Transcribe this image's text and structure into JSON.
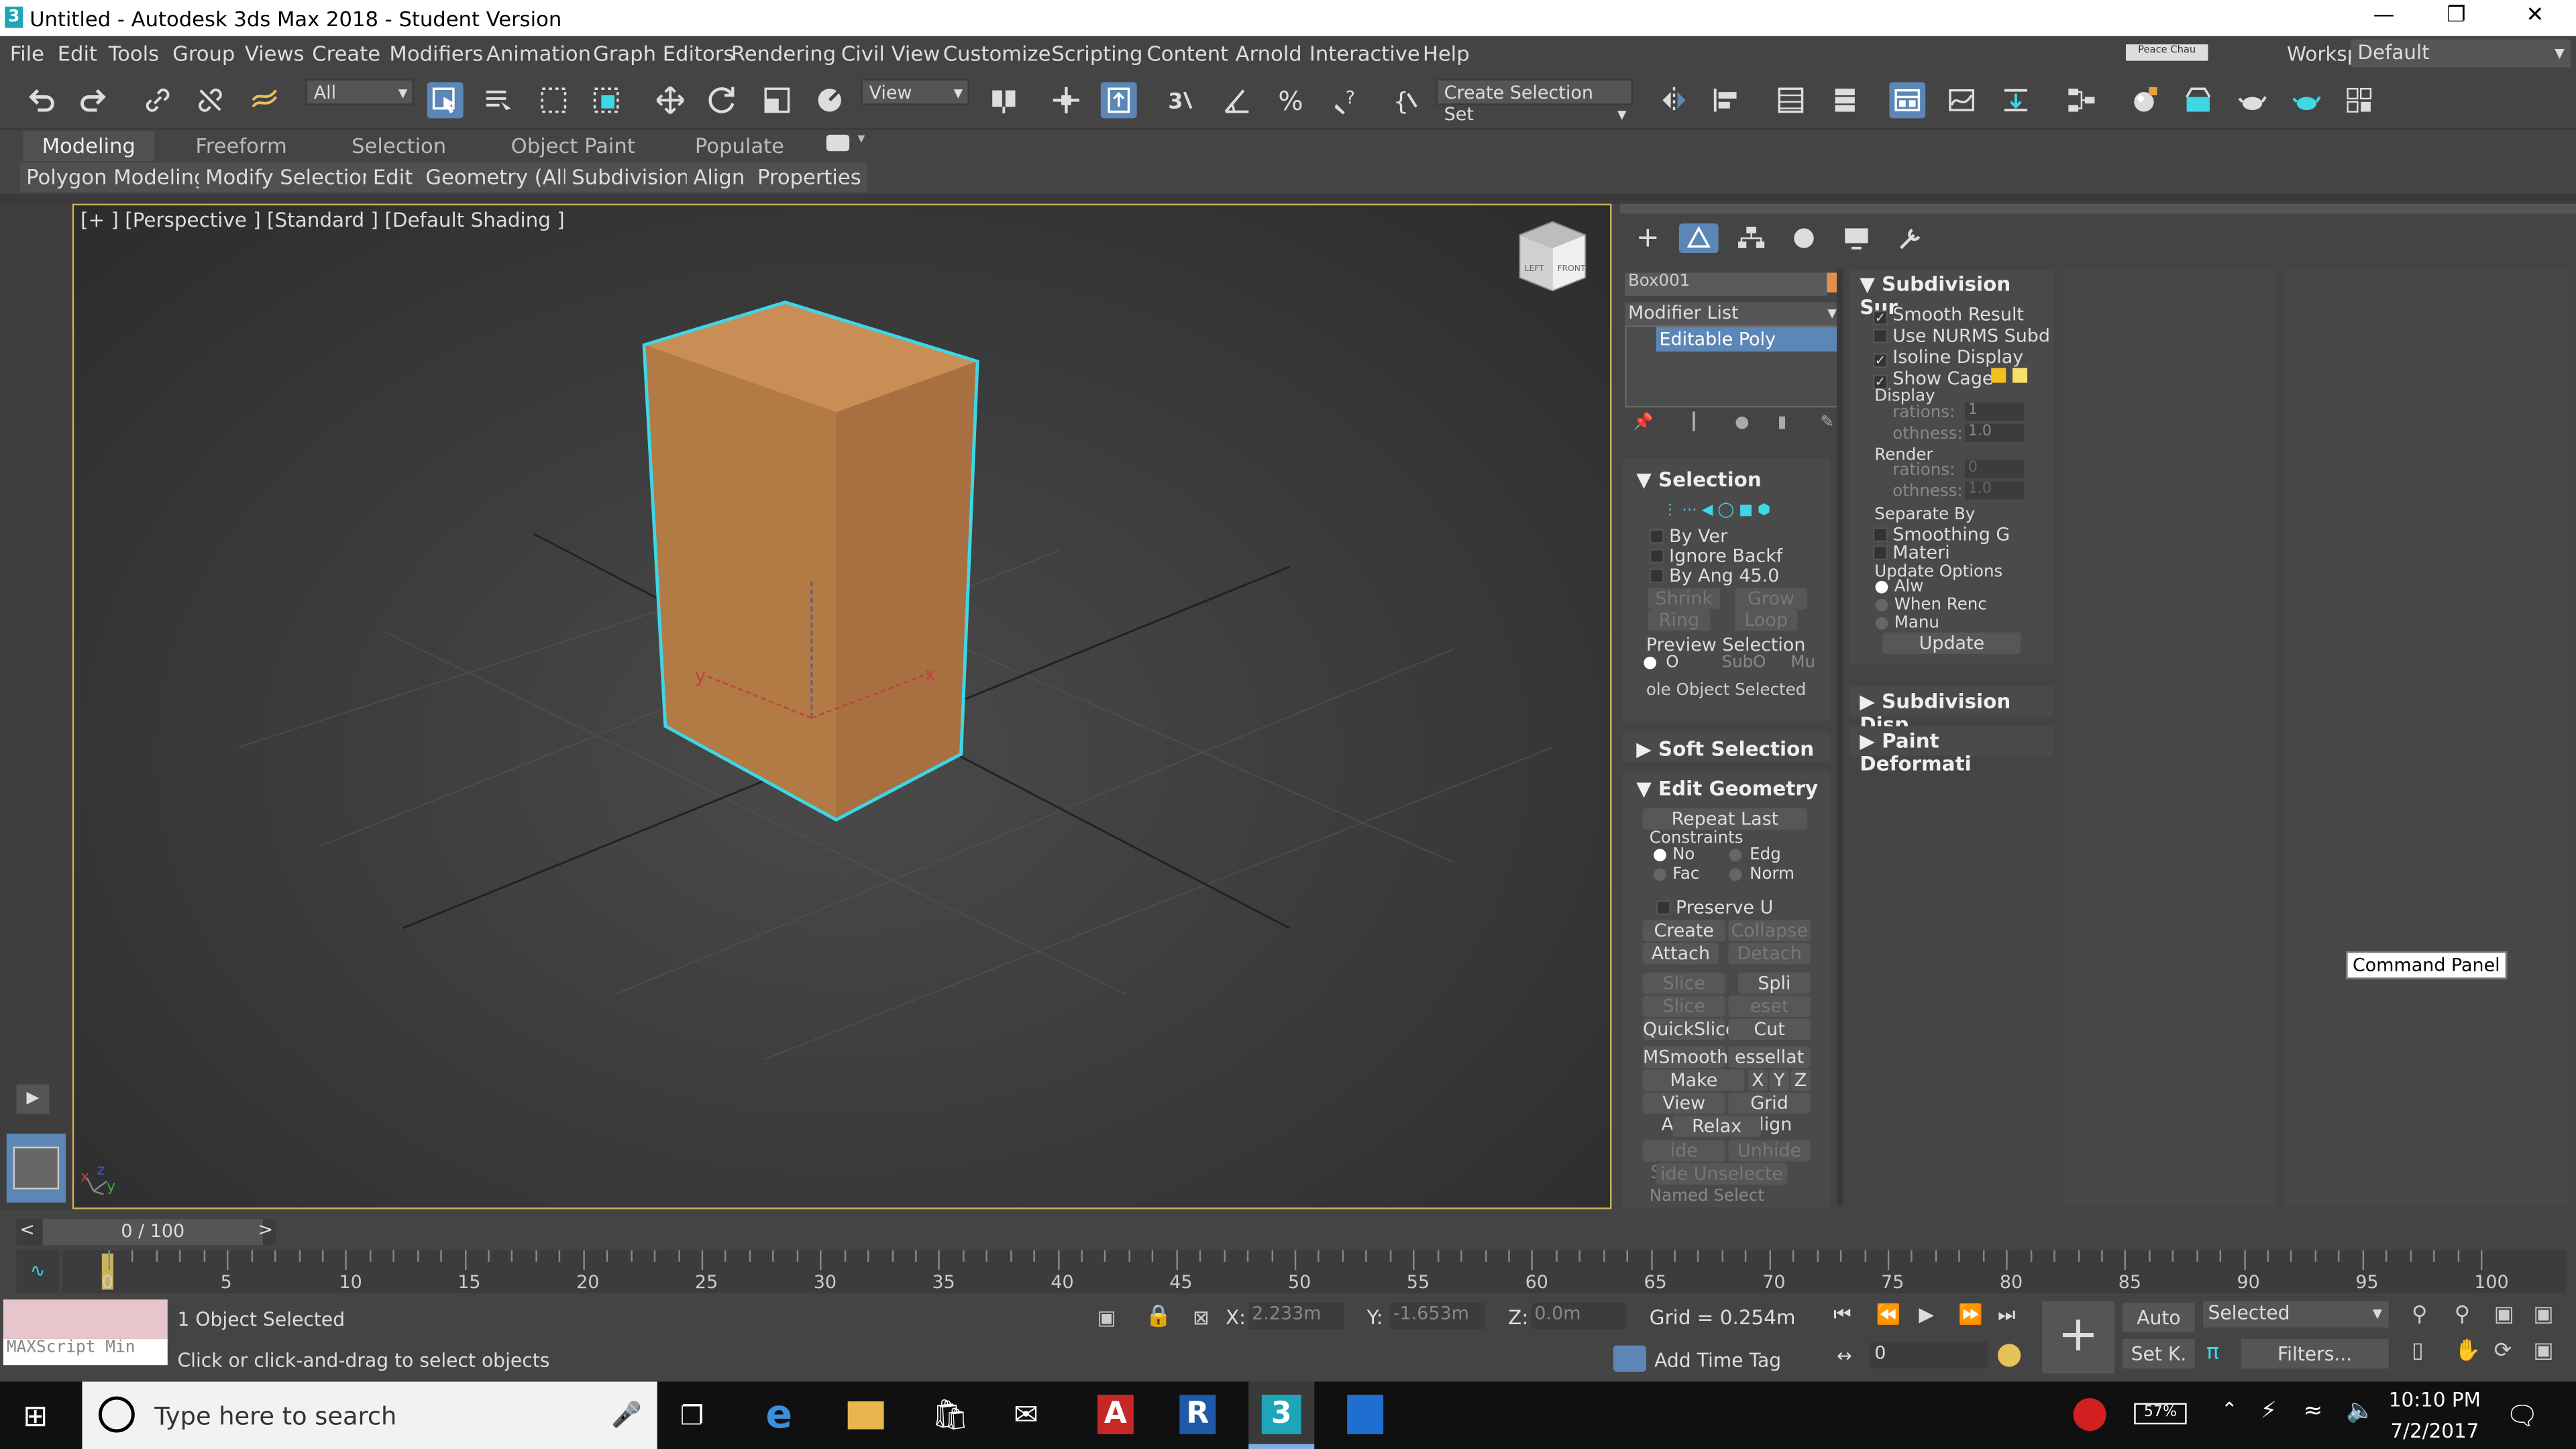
{
  "window": {
    "title": "Untitled - Autodesk 3ds Max 2018 - Student Version"
  },
  "menu": [
    "File",
    "Edit",
    "Tools",
    "Group",
    "Views",
    "Create",
    "Modifiers",
    "Animation",
    "Graph Editors",
    "Rendering",
    "Civil View",
    "Customize",
    "Scripting",
    "Content",
    "Arnold",
    "Interactive",
    "Help"
  ],
  "workspaces": {
    "label": "Workspaces:",
    "value": "Default",
    "user": "Peace Chau"
  },
  "toolbar": {
    "filter_value": "All",
    "refcoord_value": "View",
    "selection_set": "Create Selection Set"
  },
  "ribbon": {
    "tabs": [
      "Modeling",
      "Freeform",
      "Selection",
      "Object Paint",
      "Populate"
    ],
    "subtabs": [
      "Polygon Modeling",
      "Modify Selection",
      "Edit",
      "Geometry (All)",
      "Subdivision",
      "Align",
      "Properties"
    ]
  },
  "viewport": {
    "label": "[+ ] [Perspective ]  [Standard ]  [Default Shading ]",
    "viewcube_left": "LEFT",
    "viewcube_front": "FRONT"
  },
  "command_panel": {
    "object_name": "Box001",
    "modifier_list": "Modifier List",
    "stack_item": "Editable Poly",
    "tooltip": "Command Panel",
    "selection": {
      "title": "Selection",
      "by_vertex": "By Ver",
      "ignore_backfacing": "Ignore Backf",
      "by_angle": "By Ang",
      "by_angle_value": "45.0",
      "shrink": "Shrink",
      "grow": "Grow",
      "ring": "Ring",
      "loop": "Loop",
      "preview_selection": "Preview Selection",
      "preview_off": "O",
      "preview_subobj": "SubO",
      "preview_multi": "Mu",
      "whole_object": "ole Object Selected"
    },
    "soft_selection": {
      "title": "Soft Selection"
    },
    "edit_geometry": {
      "title": "Edit Geometry",
      "repeat_last": "Repeat Last",
      "constraints": "Constraints",
      "none": "No",
      "edge": "Edg",
      "face": "Fac",
      "normal": "Norm",
      "preserve_uvs": "Preserve U",
      "create": "Create",
      "collapse": "Collapse",
      "attach": "Attach",
      "detach": "Detach",
      "slice_plane": "Slice Plane",
      "split": "Spli",
      "slice": "Slice",
      "reset_plane": "eset Plan",
      "quickslice": "QuickSlice",
      "cut": "Cut",
      "msmooth": "MSmooth",
      "tessellate": "essellat",
      "make_planar": "Make Planar",
      "x": "X",
      "y": "Y",
      "z": "Z",
      "view_align": "View Align",
      "grid_align": "Grid Align",
      "relax": "Relax",
      "hide_selected": "ide Selecte",
      "unhide_all": "Unhide All",
      "hide_unselected": "ide Unselecte",
      "named_selections": "Named Select"
    },
    "subdivision_surface": {
      "title": "Subdivision Sur",
      "smooth_result": "Smooth Result",
      "use_nurms": "Use NURMS Subd",
      "isoline": "Isoline Display",
      "show_cage": "Show Cage",
      "display": "Display",
      "iterations": "rations:",
      "iterations_value": "1",
      "smoothness": "othness:",
      "smoothness_value": "1.0",
      "render": "Render",
      "r_iterations": "rations:",
      "r_iterations_value": "0",
      "r_smoothness": "othness:",
      "r_smoothness_value": "1.0",
      "separate_by": "Separate By",
      "smoothing_groups": "Smoothing G",
      "materials": "Materi",
      "update_options": "Update Options",
      "always": "Alw",
      "when_rendering": "When Renc",
      "manually": "Manu",
      "update": "Update"
    },
    "subdivision_displacement": {
      "title": "Subdivision Disp"
    },
    "paint_deformation": {
      "title": "Paint Deformati"
    }
  },
  "timeline": {
    "frame": "0 / 100",
    "ticks": [
      "0",
      "5",
      "10",
      "15",
      "20",
      "25",
      "30",
      "35",
      "40",
      "45",
      "50",
      "55",
      "60",
      "65",
      "70",
      "75",
      "80",
      "85",
      "90",
      "95",
      "100"
    ]
  },
  "status": {
    "objects_selected": "1 Object Selected",
    "prompt": "Click or click-and-drag to select objects",
    "maxscript": "MAXScript Min",
    "x_label": "X:",
    "x_value": "2.233m",
    "y_label": "Y:",
    "y_value": "-1.653m",
    "z_label": "Z:",
    "z_value": "0.0m",
    "grid": "Grid = 0.254m",
    "add_time_tag": "Add Time Tag",
    "auto": "Auto",
    "set_key": "Set K.",
    "selected": "Selected",
    "filters": "Filters...",
    "frame_input": "0"
  },
  "taskbar": {
    "search": "Type here to search",
    "time": "10:10 PM",
    "date": "7/2/2017",
    "battery": "57%"
  },
  "colors": {
    "box_top": "#c98e55",
    "box_left": "#b27a45",
    "box_right": "#a87040",
    "selection": "#3fd6e6",
    "accent": "#5b86b6"
  }
}
